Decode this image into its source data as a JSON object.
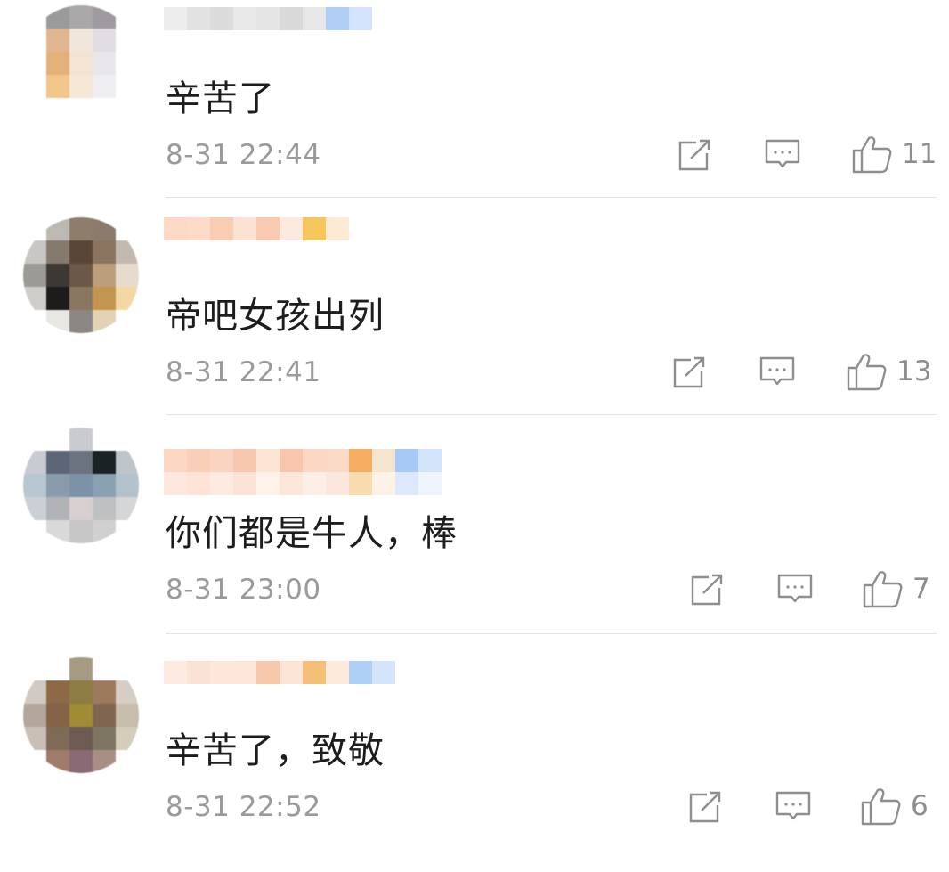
{
  "comments": [
    {
      "text": "辛苦了",
      "timestamp": "8-31 22:44",
      "likes": "11",
      "avatar_colors": [
        "#ffffff",
        "#9a9a9a",
        "#aaa7a8",
        "#9f9aa0",
        "#ffffff",
        "#ffffff",
        "#e0b690",
        "#f1e6dc",
        "#e2dde3",
        "#ffffff",
        "#ffffff",
        "#e4b07a",
        "#f3e3d2",
        "#e9e7ec",
        "#ffffff",
        "#ffffff",
        "#f2c588",
        "#f5e8d6",
        "#efeef2",
        "#ffffff",
        "#ffffff",
        "#ffffff",
        "#ffffff",
        "#ffffff",
        "#ffffff"
      ],
      "name_colors_top": [
        "#ececec",
        "#e0e0e0",
        "#d8d8d8",
        "#e8e8e8",
        "#e3e3e3",
        "#d6d6d6",
        "#e6e6e6",
        "#a9cbf6",
        "#cfe1fb"
      ],
      "name_colors_bottom": []
    },
    {
      "text": "帝吧女孩出列",
      "timestamp": "8-31 22:41",
      "likes": "13",
      "avatar_colors": [
        "#ffffff",
        "#bcb9b3",
        "#8f7d6b",
        "#8c7b6c",
        "#ffffff",
        "#c9c7c4",
        "#86796d",
        "#5a4637",
        "#8b7460",
        "#c2bab0",
        "#9c9a97",
        "#3d3833",
        "#6c5847",
        "#bc9f7a",
        "#e6dccd",
        "#cfcdca",
        "#1e1c1a",
        "#8a7761",
        "#c29650",
        "#f3d8a4",
        "#ffffff",
        "#e9e7e3",
        "#8a8784",
        "#e3d3b6",
        "#ffffff"
      ],
      "name_colors_top": [
        "#fbd6c2",
        "#fcd8c5",
        "#f8c9ae",
        "#fbe0d0",
        "#f7c6ab",
        "#fde9dd",
        "#f4c24f",
        "#fde9d2"
      ],
      "name_colors_bottom": []
    },
    {
      "text": "你们都是牛人，棒",
      "timestamp": "8-31 23:00",
      "likes": "7",
      "avatar_colors": [
        "#ffffff",
        "#ffffff",
        "#c9cbd0",
        "#ffffff",
        "#ffffff",
        "#c8ccd2",
        "#5d6676",
        "#6b7280",
        "#1b2226",
        "#bfc4ca",
        "#b9c7d2",
        "#8a9cac",
        "#7c93a7",
        "#8aa0b3",
        "#b3c1cc",
        "#c9d0d6",
        "#b2b3b7",
        "#d8cfd1",
        "#bfc0c2",
        "#d4d6d8",
        "#ffffff",
        "#d9d9d9",
        "#c7c7c7",
        "#d0d0d0",
        "#ffffff"
      ],
      "name_colors_top": [
        "#fbd4c0",
        "#f9cbb2",
        "#fad1bb",
        "#f7c4a8",
        "#fde3d3",
        "#f7c2a5",
        "#fbd4c0",
        "#f9d7c3",
        "#f2a653",
        "#f5e3cc",
        "#9fc6f4",
        "#cfe2fa"
      ],
      "name_colors_bottom": [
        "#fde7dc",
        "#fde2d4",
        "#fdeae0",
        "#fbe2d4",
        "#fef1e9",
        "#fde6d9",
        "#fdeee5",
        "#fbe6d9",
        "#f8d9a8",
        "#fdf1e3",
        "#dbe8fb",
        "#eef4fd"
      ]
    },
    {
      "text": "辛苦了，致敬",
      "timestamp": "8-31 22:52",
      "likes": "6",
      "avatar_colors": [
        "#ffffff",
        "#ffffff",
        "#a69a83",
        "#ffffff",
        "#ffffff",
        "#d3c9c3",
        "#8d6a45",
        "#8d7c43",
        "#9e7a5c",
        "#d6cdc4",
        "#b3a79d",
        "#836246",
        "#a08c34",
        "#806650",
        "#c8bcaa",
        "#c9bfb6",
        "#7e6a57",
        "#6d5a52",
        "#7f7563",
        "#d4cbb9",
        "#ffffff",
        "#a07a6a",
        "#8a6a74",
        "#a98e84",
        "#ffffff"
      ],
      "name_colors_top": [
        "#fde9df",
        "#fbe0d3",
        "#fde5d9",
        "#fbe4d6",
        "#f8c4a6",
        "#fde3d2",
        "#f4bb6c",
        "#fde9d7",
        "#a8cbf6",
        "#d1e3fb"
      ],
      "name_colors_bottom": []
    }
  ],
  "icons": {
    "share": "share-icon",
    "reply": "reply-icon",
    "like": "thumbs-up-icon"
  },
  "colors": {
    "text": "#1d1d1d",
    "meta": "#9a9a9a",
    "icon": "#8e8e8e",
    "divider": "#e4e4e4"
  }
}
